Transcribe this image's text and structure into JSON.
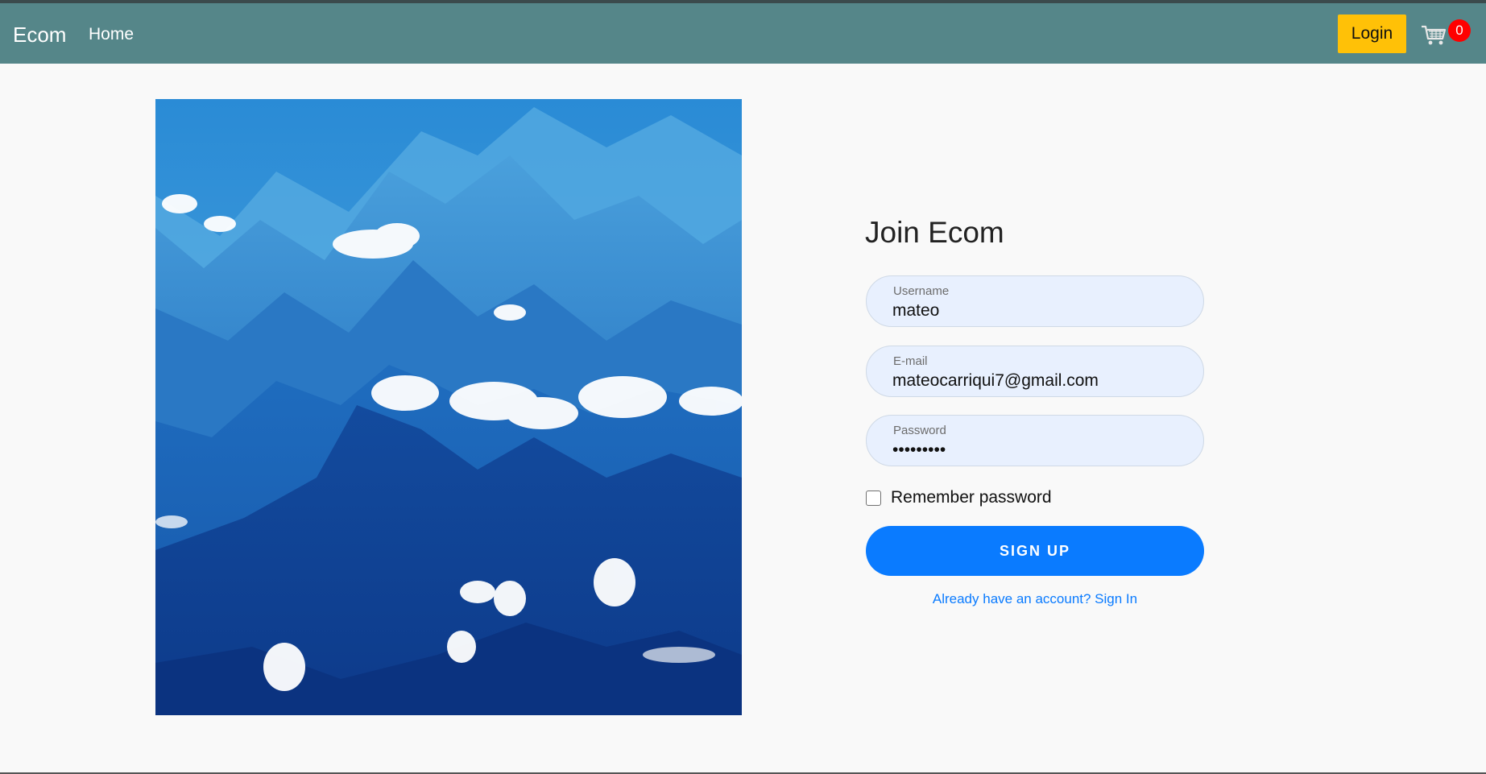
{
  "navbar": {
    "brand": "Ecom",
    "home_link": "Home",
    "login_button": "Login",
    "cart_count": "0",
    "background_color": "#558689",
    "login_color": "#ffc107"
  },
  "hero": {
    "icon": "mountain-landscape-image"
  },
  "form": {
    "title": "Join Ecom",
    "username": {
      "label": "Username",
      "value": "mateo"
    },
    "email": {
      "label": "E-mail",
      "value": "mateocarriqui7@gmail.com"
    },
    "password": {
      "label": "Password",
      "value": "123456789"
    },
    "remember_label": "Remember password",
    "submit_label": "SIGN UP",
    "signin_link": "Already have an account? Sign In",
    "accent_color": "#0a7bff",
    "field_background": "#e8f0fe"
  }
}
